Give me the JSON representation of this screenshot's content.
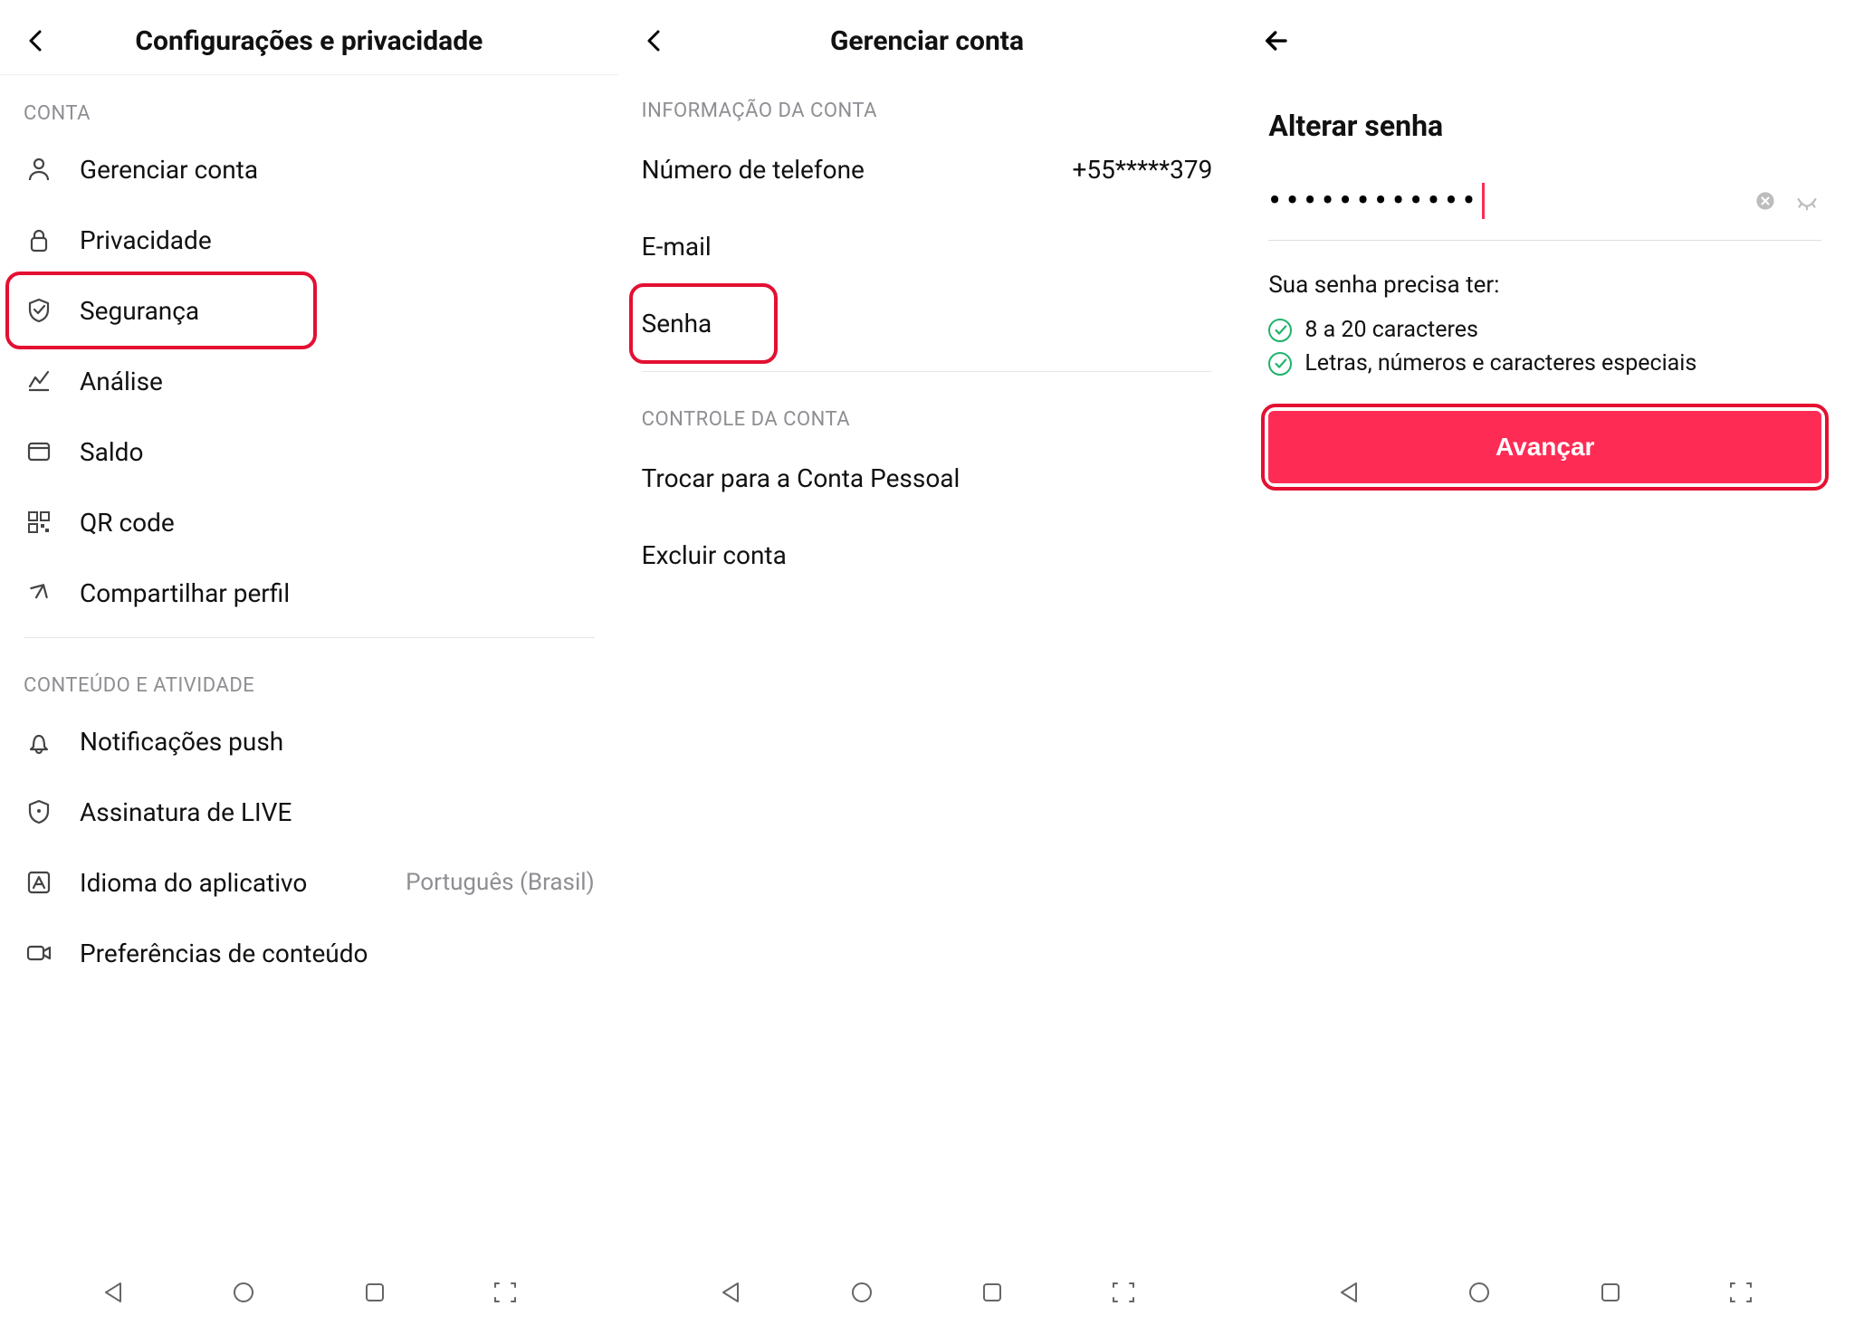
{
  "screen1": {
    "title": "Configurações e privacidade",
    "sections": {
      "conta": {
        "header": "CONTA",
        "items": [
          {
            "label": "Gerenciar conta",
            "icon": "person"
          },
          {
            "label": "Privacidade",
            "icon": "lock"
          },
          {
            "label": "Segurança",
            "icon": "shield",
            "highlighted": true
          },
          {
            "label": "Análise",
            "icon": "chart"
          },
          {
            "label": "Saldo",
            "icon": "wallet"
          },
          {
            "label": "QR code",
            "icon": "qr"
          },
          {
            "label": "Compartilhar perfil",
            "icon": "share"
          }
        ]
      },
      "conteudo": {
        "header": "CONTEÚDO E ATIVIDADE",
        "items": [
          {
            "label": "Notificações push",
            "icon": "bell"
          },
          {
            "label": "Assinatura de LIVE",
            "icon": "live-shield"
          },
          {
            "label": "Idioma do aplicativo",
            "icon": "language",
            "value": "Português (Brasil)"
          },
          {
            "label": "Preferências de conteúdo",
            "icon": "video"
          }
        ]
      }
    }
  },
  "screen2": {
    "title": "Gerenciar conta",
    "sections": {
      "info": {
        "header": "INFORMAÇÃO DA CONTA",
        "items": [
          {
            "label": "Número de telefone",
            "value": "+55*****379"
          },
          {
            "label": "E-mail"
          },
          {
            "label": "Senha",
            "highlighted": true
          }
        ]
      },
      "controle": {
        "header": "CONTROLE DA CONTA",
        "items": [
          {
            "label": "Trocar para a Conta Pessoal"
          },
          {
            "label": "Excluir conta"
          }
        ]
      }
    }
  },
  "screen3": {
    "title": "Alterar senha",
    "password_mask": "••••••••••••",
    "requirements_title": "Sua senha precisa ter:",
    "requirements": [
      "8 a 20 caracteres",
      "Letras, números e caracteres especiais"
    ],
    "primary_button": "Avançar",
    "primary_highlighted": true
  },
  "colors": {
    "highlight": "#e31032",
    "primary": "#fe2c55",
    "success": "#1fb36a",
    "muted": "#8e8e93"
  }
}
